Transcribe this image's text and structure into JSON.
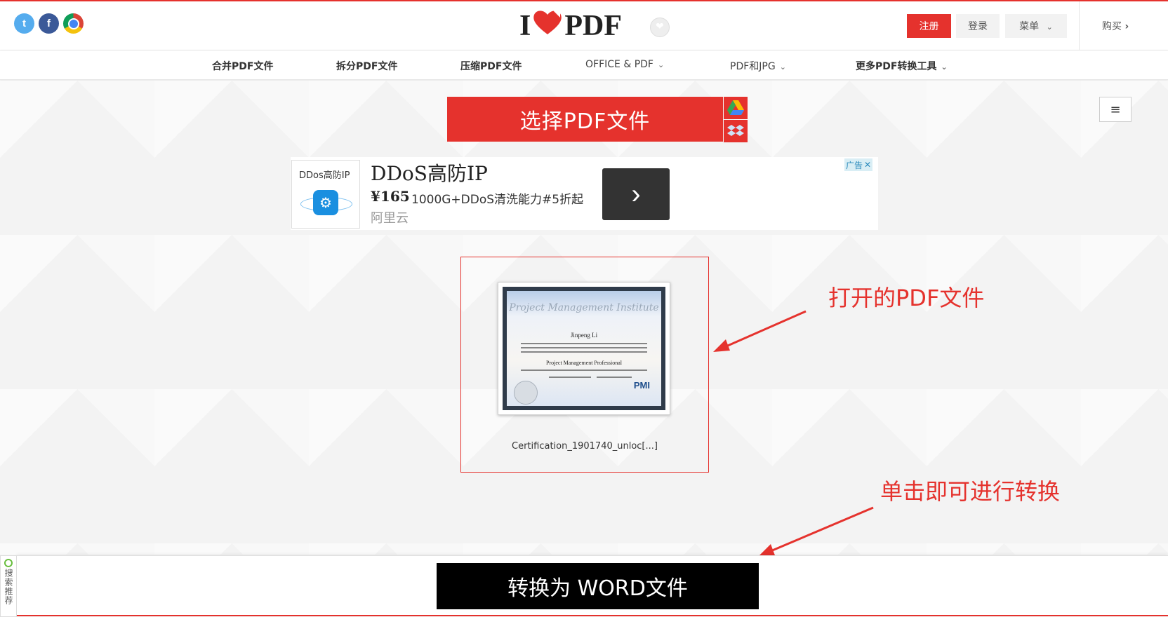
{
  "header": {
    "logo_left": "I",
    "logo_heart": "❤",
    "logo_right": "PDF",
    "register": "注册",
    "login": "登录",
    "menu": "菜单",
    "buy": "购买"
  },
  "social": [
    {
      "name": "twitter",
      "glyph": "t"
    },
    {
      "name": "facebook",
      "glyph": "f"
    },
    {
      "name": "chrome",
      "glyph": ""
    }
  ],
  "nav": {
    "merge": "合并PDF文件",
    "split": "拆分PDF文件",
    "compress": "压缩PDF文件",
    "office": "OFFICE & PDF",
    "jpg": "PDF和JPG",
    "more": "更多PDF转换工具"
  },
  "main": {
    "select_button": "选择PDF文件",
    "sidebar_toggle": "≡"
  },
  "ad": {
    "thumb_label": "DDos高防IP",
    "title": "DDoS高防IP",
    "price": "¥165",
    "description": "1000G+DDoS清洗能力#5折起",
    "brand": "阿里云",
    "tag": "广告",
    "close": "✕",
    "arrow": "›"
  },
  "file": {
    "name": "Certification_1901740_unloc[...]",
    "cert_org": "Project Management Institute",
    "cert_person": "Jinpeng Li",
    "cert_title": "Project Management Professional",
    "cert_logo": "PMI"
  },
  "annotations": {
    "opened_pdf": "打开的PDF文件",
    "click_convert": "单击即可进行转换"
  },
  "bottom": {
    "convert_button": "转换为 WORD文件"
  },
  "side_widget": {
    "label": "搜索推荐"
  },
  "colors": {
    "brand_red": "#e5322d",
    "convert_black": "#000000"
  }
}
